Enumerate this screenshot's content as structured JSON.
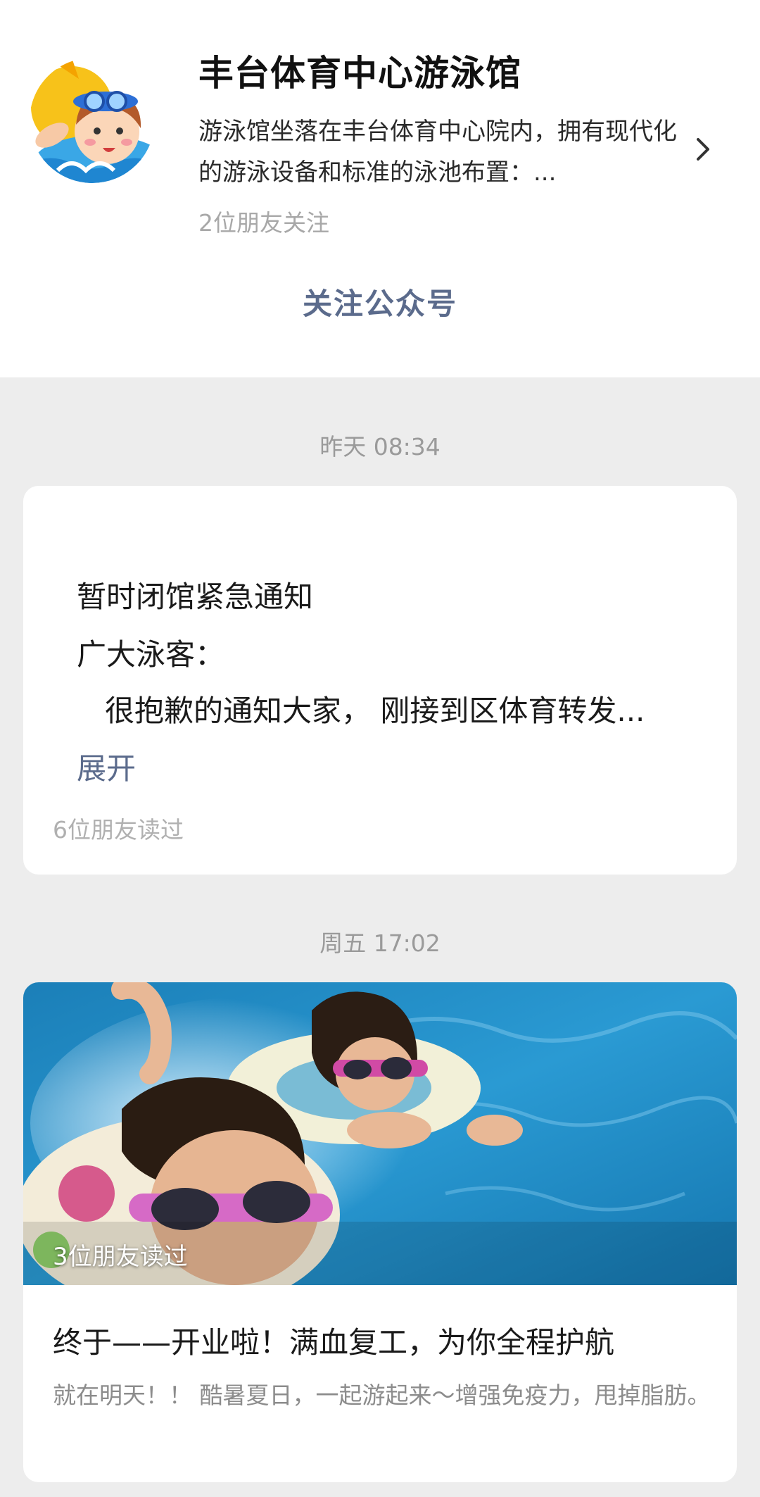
{
  "account": {
    "name": "丰台体育中心游泳馆",
    "description": "游泳馆坐落在丰台体育中心院内，拥有现代化的游泳设备和标准的泳池布置：...",
    "friends_follow": "2位朋友关注",
    "follow_button": "关注公众号"
  },
  "feed": [
    {
      "timestamp": "昨天 08:34",
      "title": "暂时闭馆紧急通知",
      "greeting": "广大泳客：",
      "body": "很抱歉的通知大家， 刚接到区体育转发...",
      "expand_label": "展开",
      "read_count": "6位朋友读过"
    },
    {
      "timestamp": "周五 17:02",
      "cover_read_count": "3位朋友读过",
      "title": "终于——开业啦！满血复工，为你全程护航",
      "summary": "就在明天！！ 酷暑夏日，一起游起来～增强免疫力，甩掉脂肪。"
    }
  ],
  "icons": {
    "avatar": "swimmer-cartoon-avatar",
    "chevron": "chevron-right-icon"
  },
  "colors": {
    "link": "#5b6b8c",
    "page_bg": "#ededed",
    "card_bg": "#ffffff"
  }
}
